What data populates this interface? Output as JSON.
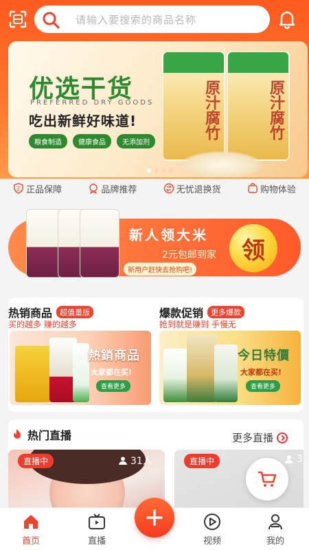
{
  "search": {
    "placeholder": "请输入要搜索的商品名称"
  },
  "banner": {
    "title": "优选干货",
    "subtitle_en": "PREFERRED DRY GOODS",
    "tagline": "吃出新鲜好味道!",
    "tags": [
      "粮食制造",
      "健康食品",
      "无添加剂"
    ],
    "product_text": "原汁腐竹",
    "active_dot": 1,
    "dot_count": 4
  },
  "features": [
    {
      "label": "正品保障",
      "icon": "authentic-icon"
    },
    {
      "label": "品牌推荐",
      "icon": "brand-icon"
    },
    {
      "label": "无忧退换货",
      "icon": "exchange-icon"
    },
    {
      "label": "购物体验",
      "icon": "shopping-icon"
    }
  ],
  "promo": {
    "title": "新人领大米",
    "subtitle": "2元包邮到家",
    "caption": "新用户赶快去抢购吧!",
    "button": "领"
  },
  "cards": {
    "hot": {
      "title": "热销商品",
      "badge": "超值量版",
      "sub": "买的越多 赚的越多",
      "img_title": "熱銷商品",
      "img_sub": "大家都在买!",
      "img_btn": "查看更多"
    },
    "deal": {
      "title": "爆款促销",
      "badge": "更多爆款",
      "sub": "抢到就是赚到 手慢无",
      "img_title": "今日特價",
      "img_sub": "大家都在买!",
      "img_btn": "查看更多"
    }
  },
  "live": {
    "title": "热门直播",
    "more": "更多直播",
    "items": [
      {
        "badge": "直播中",
        "viewers": "31人"
      },
      {
        "badge": "直播中",
        "viewers": "3"
      }
    ]
  },
  "tabbar": {
    "tabs": [
      {
        "label": "首页",
        "icon": "home-icon",
        "active": true
      },
      {
        "label": "直播",
        "icon": "tv-icon",
        "active": false
      },
      {
        "label": "视频",
        "icon": "play-icon",
        "active": false
      },
      {
        "label": "我的",
        "icon": "user-icon",
        "active": false
      }
    ],
    "center_icon": "plus-icon"
  },
  "colors": {
    "accent": "#f0422c",
    "brand_green": "#2d8a2e",
    "header": "#ff5a1f"
  }
}
